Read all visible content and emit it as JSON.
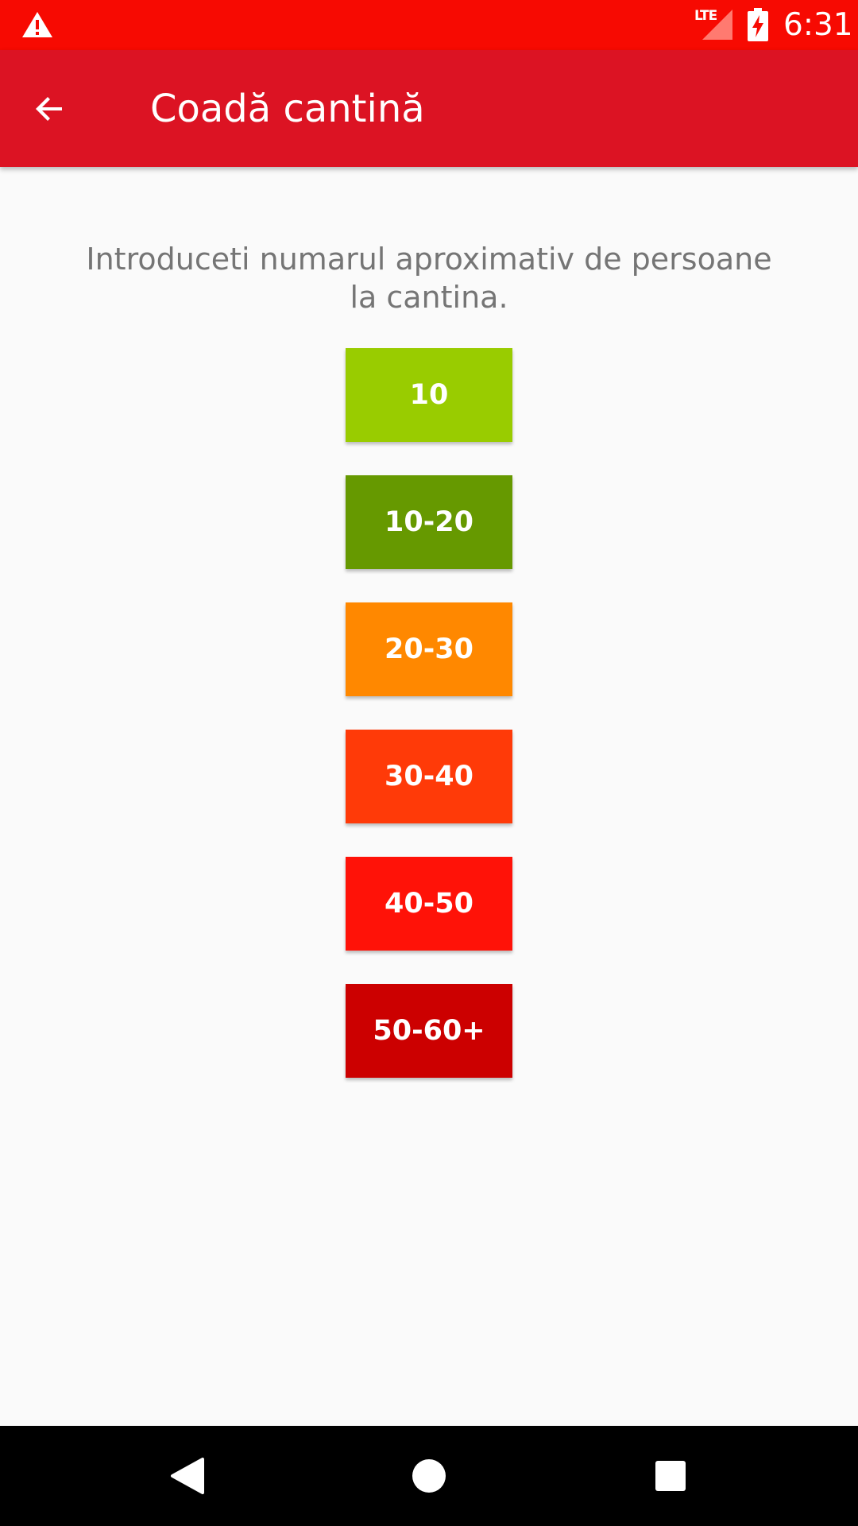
{
  "status_bar": {
    "network": "LTE",
    "time": "6:31",
    "background_color": "#f70a02",
    "icons": [
      "warning-icon",
      "signal-icon",
      "battery-charging-icon"
    ]
  },
  "app_bar": {
    "title": "Coadă cantină",
    "background_color": "#dc1323",
    "back_icon": "arrow-back-icon"
  },
  "main": {
    "instructions": "Introduceti numarul aproximativ de persoane la cantina.",
    "buttons": [
      {
        "label": "10",
        "color": "#99cc00"
      },
      {
        "label": "10-20",
        "color": "#669900"
      },
      {
        "label": "20-30",
        "color": "#ff8800"
      },
      {
        "label": "30-40",
        "color": "#ff3a08"
      },
      {
        "label": "40-50",
        "color": "#ff1208"
      },
      {
        "label": "50-60+",
        "color": "#cc0000"
      }
    ]
  },
  "nav_bar": {
    "icons": [
      "back-triangle-icon",
      "home-circle-icon",
      "recents-square-icon"
    ]
  }
}
